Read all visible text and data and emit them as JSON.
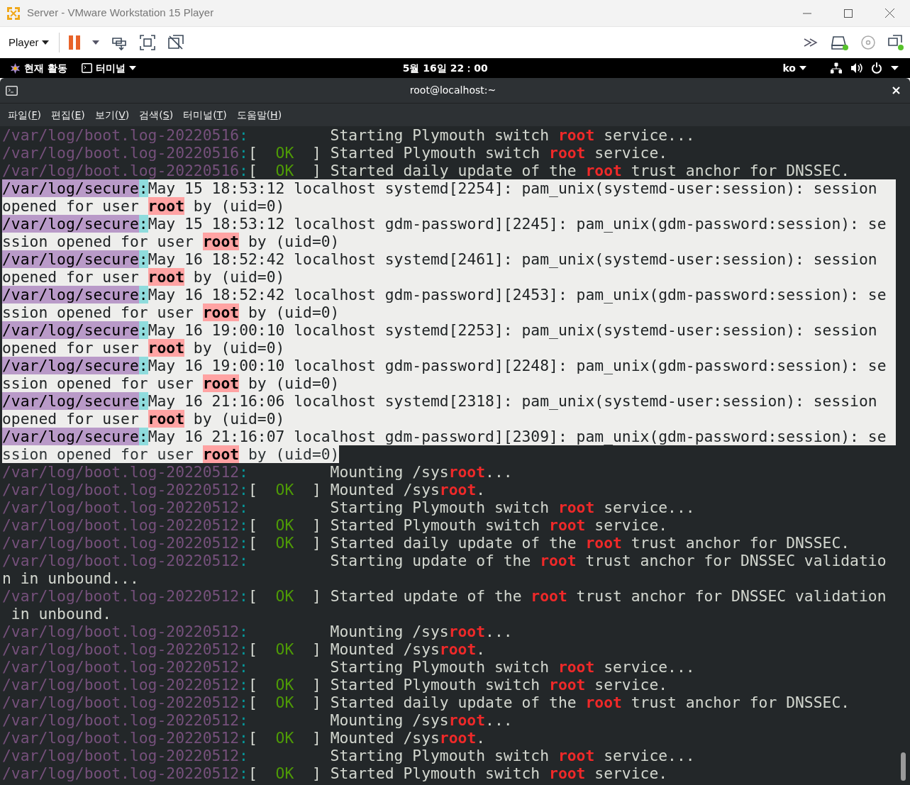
{
  "window": {
    "title": "Server - VMware Workstation 15 Player"
  },
  "toolbar": {
    "player_menu": "Player"
  },
  "top_bar": {
    "activities": "현재 활동",
    "app_menu": "터미널",
    "clock": "5월 16일  22：00",
    "input_method": "ko"
  },
  "terminal": {
    "title": "root@localhost:~",
    "menu": [
      "파일(F)",
      "편집(E)",
      "보기(V)",
      "검색(S)",
      "터미널(T)",
      "도움말(H)"
    ],
    "lines": [
      {
        "selected": false,
        "segments": [
          {
            "kind": "path",
            "text": "/var/log/boot.log-20220516"
          },
          {
            "kind": "sep",
            "text": ":"
          },
          {
            "kind": "plain",
            "text": "         Starting Plymouth switch "
          },
          {
            "kind": "match",
            "text": "root"
          },
          {
            "kind": "plain",
            "text": " service..."
          }
        ]
      },
      {
        "selected": false,
        "segments": [
          {
            "kind": "path",
            "text": "/var/log/boot.log-20220516"
          },
          {
            "kind": "sep",
            "text": ":"
          },
          {
            "kind": "plain",
            "text": "[  "
          },
          {
            "kind": "ok",
            "text": "OK"
          },
          {
            "kind": "plain",
            "text": "  ] Started Plymouth switch "
          },
          {
            "kind": "match",
            "text": "root"
          },
          {
            "kind": "plain",
            "text": " service."
          }
        ]
      },
      {
        "selected": false,
        "segments": [
          {
            "kind": "path",
            "text": "/var/log/boot.log-20220516"
          },
          {
            "kind": "sep",
            "text": ":"
          },
          {
            "kind": "plain",
            "text": "[  "
          },
          {
            "kind": "ok",
            "text": "OK"
          },
          {
            "kind": "plain",
            "text": "  ] Started daily update of the "
          },
          {
            "kind": "match",
            "text": "root"
          },
          {
            "kind": "plain",
            "text": " trust anchor for DNSSEC."
          }
        ]
      },
      {
        "selected": true,
        "segments": [
          {
            "kind": "path",
            "text": "/var/log/secure"
          },
          {
            "kind": "sep",
            "text": ":"
          },
          {
            "kind": "plain",
            "text": "May 15 18:53:12 localhost systemd[2254]: pam_unix(systemd-user:session): session"
          }
        ]
      },
      {
        "selected": true,
        "segments": [
          {
            "kind": "plain",
            "text": "opened for user "
          },
          {
            "kind": "match",
            "text": "root"
          },
          {
            "kind": "plain",
            "text": " by (uid=0)"
          }
        ]
      },
      {
        "selected": true,
        "segments": [
          {
            "kind": "path",
            "text": "/var/log/secure"
          },
          {
            "kind": "sep",
            "text": ":"
          },
          {
            "kind": "plain",
            "text": "May 15 18:53:12 localhost gdm-password][2245]: pam_unix(gdm-password:session): se"
          }
        ]
      },
      {
        "selected": true,
        "segments": [
          {
            "kind": "plain",
            "text": "ssion opened for user "
          },
          {
            "kind": "match",
            "text": "root"
          },
          {
            "kind": "plain",
            "text": " by (uid=0)"
          }
        ]
      },
      {
        "selected": true,
        "segments": [
          {
            "kind": "path",
            "text": "/var/log/secure"
          },
          {
            "kind": "sep",
            "text": ":"
          },
          {
            "kind": "plain",
            "text": "May 16 18:52:42 localhost systemd[2461]: pam_unix(systemd-user:session): session"
          }
        ]
      },
      {
        "selected": true,
        "segments": [
          {
            "kind": "plain",
            "text": "opened for user "
          },
          {
            "kind": "match",
            "text": "root"
          },
          {
            "kind": "plain",
            "text": " by (uid=0)"
          }
        ]
      },
      {
        "selected": true,
        "segments": [
          {
            "kind": "path",
            "text": "/var/log/secure"
          },
          {
            "kind": "sep",
            "text": ":"
          },
          {
            "kind": "plain",
            "text": "May 16 18:52:42 localhost gdm-password][2453]: pam_unix(gdm-password:session): se"
          }
        ]
      },
      {
        "selected": true,
        "segments": [
          {
            "kind": "plain",
            "text": "ssion opened for user "
          },
          {
            "kind": "match",
            "text": "root"
          },
          {
            "kind": "plain",
            "text": " by (uid=0)"
          }
        ]
      },
      {
        "selected": true,
        "segments": [
          {
            "kind": "path",
            "text": "/var/log/secure"
          },
          {
            "kind": "sep",
            "text": ":"
          },
          {
            "kind": "plain",
            "text": "May 16 19:00:10 localhost systemd[2253]: pam_unix(systemd-user:session): session"
          }
        ]
      },
      {
        "selected": true,
        "segments": [
          {
            "kind": "plain",
            "text": "opened for user "
          },
          {
            "kind": "match",
            "text": "root"
          },
          {
            "kind": "plain",
            "text": " by (uid=0)"
          }
        ]
      },
      {
        "selected": true,
        "segments": [
          {
            "kind": "path",
            "text": "/var/log/secure"
          },
          {
            "kind": "sep",
            "text": ":"
          },
          {
            "kind": "plain",
            "text": "May 16 19:00:10 localhost gdm-password][2248]: pam_unix(gdm-password:session): se"
          }
        ]
      },
      {
        "selected": true,
        "segments": [
          {
            "kind": "plain",
            "text": "ssion opened for user "
          },
          {
            "kind": "match",
            "text": "root"
          },
          {
            "kind": "plain",
            "text": " by (uid=0)"
          }
        ]
      },
      {
        "selected": true,
        "segments": [
          {
            "kind": "path",
            "text": "/var/log/secure"
          },
          {
            "kind": "sep",
            "text": ":"
          },
          {
            "kind": "plain",
            "text": "May 16 21:16:06 localhost systemd[2318]: pam_unix(systemd-user:session): session"
          }
        ]
      },
      {
        "selected": true,
        "segments": [
          {
            "kind": "plain",
            "text": "opened for user "
          },
          {
            "kind": "match",
            "text": "root"
          },
          {
            "kind": "plain",
            "text": " by (uid=0)"
          }
        ]
      },
      {
        "selected": true,
        "segments": [
          {
            "kind": "path",
            "text": "/var/log/secure"
          },
          {
            "kind": "sep",
            "text": ":"
          },
          {
            "kind": "plain",
            "text": "May 16 21:16:07 localhost gdm-password][2309]: pam_unix(gdm-password:session): se"
          }
        ]
      },
      {
        "selected": true,
        "segments": [
          {
            "kind": "plain",
            "text": "ssion opened for user "
          },
          {
            "kind": "match",
            "text": "root"
          },
          {
            "kind": "plain",
            "text": " by (uid=0)"
          }
        ]
      },
      {
        "selected": false,
        "segments": [
          {
            "kind": "path",
            "text": "/var/log/boot.log-20220512"
          },
          {
            "kind": "sep",
            "text": ":"
          },
          {
            "kind": "plain",
            "text": "         Mounting /sys"
          },
          {
            "kind": "match",
            "text": "root"
          },
          {
            "kind": "plain",
            "text": "..."
          }
        ]
      },
      {
        "selected": false,
        "segments": [
          {
            "kind": "path",
            "text": "/var/log/boot.log-20220512"
          },
          {
            "kind": "sep",
            "text": ":"
          },
          {
            "kind": "plain",
            "text": "[  "
          },
          {
            "kind": "ok",
            "text": "OK"
          },
          {
            "kind": "plain",
            "text": "  ] Mounted /sys"
          },
          {
            "kind": "match",
            "text": "root"
          },
          {
            "kind": "plain",
            "text": "."
          }
        ]
      },
      {
        "selected": false,
        "segments": [
          {
            "kind": "path",
            "text": "/var/log/boot.log-20220512"
          },
          {
            "kind": "sep",
            "text": ":"
          },
          {
            "kind": "plain",
            "text": "         Starting Plymouth switch "
          },
          {
            "kind": "match",
            "text": "root"
          },
          {
            "kind": "plain",
            "text": " service..."
          }
        ]
      },
      {
        "selected": false,
        "segments": [
          {
            "kind": "path",
            "text": "/var/log/boot.log-20220512"
          },
          {
            "kind": "sep",
            "text": ":"
          },
          {
            "kind": "plain",
            "text": "[  "
          },
          {
            "kind": "ok",
            "text": "OK"
          },
          {
            "kind": "plain",
            "text": "  ] Started Plymouth switch "
          },
          {
            "kind": "match",
            "text": "root"
          },
          {
            "kind": "plain",
            "text": " service."
          }
        ]
      },
      {
        "selected": false,
        "segments": [
          {
            "kind": "path",
            "text": "/var/log/boot.log-20220512"
          },
          {
            "kind": "sep",
            "text": ":"
          },
          {
            "kind": "plain",
            "text": "[  "
          },
          {
            "kind": "ok",
            "text": "OK"
          },
          {
            "kind": "plain",
            "text": "  ] Started daily update of the "
          },
          {
            "kind": "match",
            "text": "root"
          },
          {
            "kind": "plain",
            "text": " trust anchor for DNSSEC."
          }
        ]
      },
      {
        "selected": false,
        "segments": [
          {
            "kind": "path",
            "text": "/var/log/boot.log-20220512"
          },
          {
            "kind": "sep",
            "text": ":"
          },
          {
            "kind": "plain",
            "text": "         Starting update of the "
          },
          {
            "kind": "match",
            "text": "root"
          },
          {
            "kind": "plain",
            "text": " trust anchor for DNSSEC validatio"
          }
        ]
      },
      {
        "selected": false,
        "segments": [
          {
            "kind": "plain",
            "text": "n in unbound..."
          }
        ]
      },
      {
        "selected": false,
        "segments": [
          {
            "kind": "path",
            "text": "/var/log/boot.log-20220512"
          },
          {
            "kind": "sep",
            "text": ":"
          },
          {
            "kind": "plain",
            "text": "[  "
          },
          {
            "kind": "ok",
            "text": "OK"
          },
          {
            "kind": "plain",
            "text": "  ] Started update of the "
          },
          {
            "kind": "match",
            "text": "root"
          },
          {
            "kind": "plain",
            "text": " trust anchor for DNSSEC validation"
          }
        ]
      },
      {
        "selected": false,
        "segments": [
          {
            "kind": "plain",
            "text": " in unbound."
          }
        ]
      },
      {
        "selected": false,
        "segments": [
          {
            "kind": "path",
            "text": "/var/log/boot.log-20220512"
          },
          {
            "kind": "sep",
            "text": ":"
          },
          {
            "kind": "plain",
            "text": "         Mounting /sys"
          },
          {
            "kind": "match",
            "text": "root"
          },
          {
            "kind": "plain",
            "text": "..."
          }
        ]
      },
      {
        "selected": false,
        "segments": [
          {
            "kind": "path",
            "text": "/var/log/boot.log-20220512"
          },
          {
            "kind": "sep",
            "text": ":"
          },
          {
            "kind": "plain",
            "text": "[  "
          },
          {
            "kind": "ok",
            "text": "OK"
          },
          {
            "kind": "plain",
            "text": "  ] Mounted /sys"
          },
          {
            "kind": "match",
            "text": "root"
          },
          {
            "kind": "plain",
            "text": "."
          }
        ]
      },
      {
        "selected": false,
        "segments": [
          {
            "kind": "path",
            "text": "/var/log/boot.log-20220512"
          },
          {
            "kind": "sep",
            "text": ":"
          },
          {
            "kind": "plain",
            "text": "         Starting Plymouth switch "
          },
          {
            "kind": "match",
            "text": "root"
          },
          {
            "kind": "plain",
            "text": " service..."
          }
        ]
      },
      {
        "selected": false,
        "segments": [
          {
            "kind": "path",
            "text": "/var/log/boot.log-20220512"
          },
          {
            "kind": "sep",
            "text": ":"
          },
          {
            "kind": "plain",
            "text": "[  "
          },
          {
            "kind": "ok",
            "text": "OK"
          },
          {
            "kind": "plain",
            "text": "  ] Started Plymouth switch "
          },
          {
            "kind": "match",
            "text": "root"
          },
          {
            "kind": "plain",
            "text": " service."
          }
        ]
      },
      {
        "selected": false,
        "segments": [
          {
            "kind": "path",
            "text": "/var/log/boot.log-20220512"
          },
          {
            "kind": "sep",
            "text": ":"
          },
          {
            "kind": "plain",
            "text": "[  "
          },
          {
            "kind": "ok",
            "text": "OK"
          },
          {
            "kind": "plain",
            "text": "  ] Started daily update of the "
          },
          {
            "kind": "match",
            "text": "root"
          },
          {
            "kind": "plain",
            "text": " trust anchor for DNSSEC."
          }
        ]
      },
      {
        "selected": false,
        "segments": [
          {
            "kind": "path",
            "text": "/var/log/boot.log-20220512"
          },
          {
            "kind": "sep",
            "text": ":"
          },
          {
            "kind": "plain",
            "text": "         Mounting /sys"
          },
          {
            "kind": "match",
            "text": "root"
          },
          {
            "kind": "plain",
            "text": "..."
          }
        ]
      },
      {
        "selected": false,
        "segments": [
          {
            "kind": "path",
            "text": "/var/log/boot.log-20220512"
          },
          {
            "kind": "sep",
            "text": ":"
          },
          {
            "kind": "plain",
            "text": "[  "
          },
          {
            "kind": "ok",
            "text": "OK"
          },
          {
            "kind": "plain",
            "text": "  ] Mounted /sys"
          },
          {
            "kind": "match",
            "text": "root"
          },
          {
            "kind": "plain",
            "text": "."
          }
        ]
      },
      {
        "selected": false,
        "segments": [
          {
            "kind": "path",
            "text": "/var/log/boot.log-20220512"
          },
          {
            "kind": "sep",
            "text": ":"
          },
          {
            "kind": "plain",
            "text": "         Starting Plymouth switch "
          },
          {
            "kind": "match",
            "text": "root"
          },
          {
            "kind": "plain",
            "text": " service..."
          }
        ]
      },
      {
        "selected": false,
        "segments": [
          {
            "kind": "path",
            "text": "/var/log/boot.log-20220512"
          },
          {
            "kind": "sep",
            "text": ":"
          },
          {
            "kind": "plain",
            "text": "[  "
          },
          {
            "kind": "ok",
            "text": "OK"
          },
          {
            "kind": "plain",
            "text": "  ] Started Plymouth switch "
          },
          {
            "kind": "match",
            "text": "root"
          },
          {
            "kind": "plain",
            "text": " service."
          }
        ]
      }
    ]
  }
}
